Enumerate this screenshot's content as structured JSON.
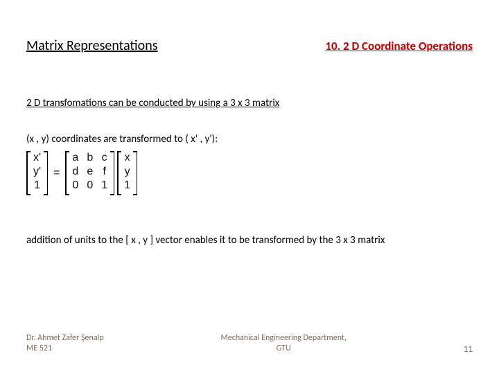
{
  "header": {
    "left": "Matrix Representations",
    "right": "10. 2 D Coordinate Operations"
  },
  "body": {
    "line1": "2 D transfomations can be conducted by using a 3 x 3 matrix",
    "line2": "(x , y) coordinates are transformed to ( x' , y'):",
    "line3": "addition of units to the [ x , y ] vector enables it to be transformed by the 3 x 3 matrix"
  },
  "matrix": {
    "lhs": [
      "x'",
      "y'",
      "1"
    ],
    "eq": "=",
    "m": [
      [
        "a",
        "b",
        "c"
      ],
      [
        "d",
        "e",
        "f"
      ],
      [
        "0",
        "0",
        "1"
      ]
    ],
    "rhs": [
      "x",
      "y",
      "1"
    ]
  },
  "footer": {
    "author": "Dr. Ahmet Zafer Şenalp",
    "course": "ME 521",
    "dept1": "Mechanical Engineering Department,",
    "dept2": "GTU",
    "page": "11"
  }
}
